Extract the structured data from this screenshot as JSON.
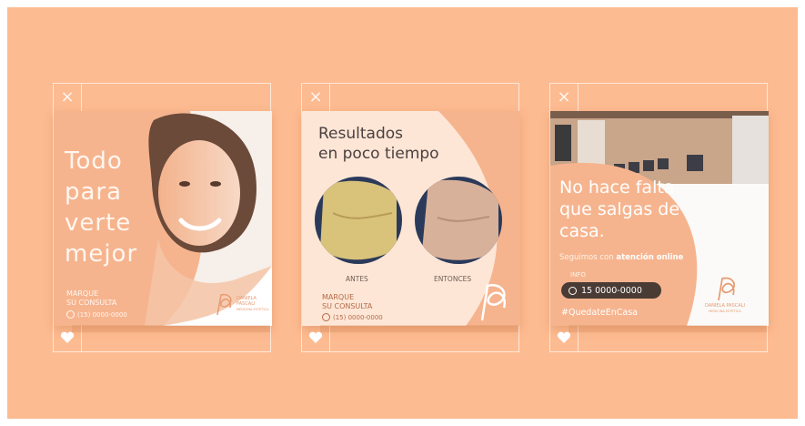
{
  "colors": {
    "background": "#fdbb91",
    "accent": "#f6b48e",
    "dark_pill": "#4a3b35"
  },
  "icons": {
    "close": "×",
    "heart": "heart-icon",
    "whatsapp": "whatsapp-icon",
    "logo": "dp-logo-icon"
  },
  "posts": [
    {
      "headline_lines": [
        "Todo",
        "para",
        "verte",
        "mejor"
      ],
      "cta_line1": "MARQUE",
      "cta_line2": "SU CONSULTA",
      "phone": "(15) 0000-0000",
      "brand_line1": "DANIELA",
      "brand_line2": "PASCALI",
      "brand_line3": "MEDICINA ESTÉTICA"
    },
    {
      "title_line1": "Resultados",
      "title_line2": "en poco tiempo",
      "before_label": "ANTES",
      "after_label": "ENTONCES",
      "cta_line1": "MARQUE",
      "cta_line2": "SU CONSULTA",
      "phone": "(15) 0000-0000"
    },
    {
      "headline_lines": [
        "No hace falta",
        "que salgas de",
        "casa."
      ],
      "sub_prefix": "Seguimos con",
      "sub_highlight": "atención online",
      "info_label": "INFO",
      "phone": "15 0000-0000",
      "hashtag": "#QuedateEnCasa",
      "brand_line1": "DANIELA PASCALI",
      "brand_line2": "MEDICINA ESTÉTICA"
    }
  ]
}
